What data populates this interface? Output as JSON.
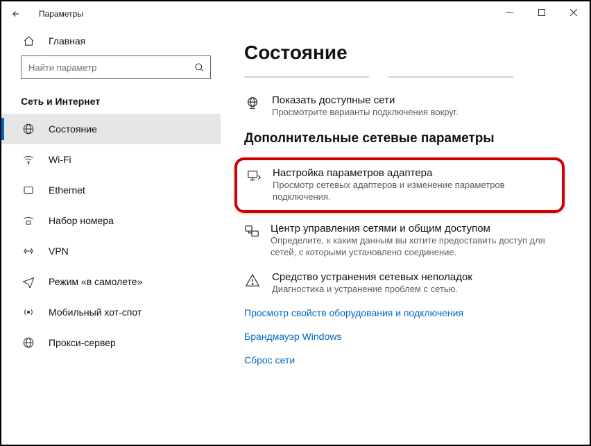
{
  "window": {
    "title": "Параметры"
  },
  "sidebar": {
    "home": "Главная",
    "search_placeholder": "Найти параметр",
    "category": "Сеть и Интернет",
    "items": [
      {
        "label": "Состояние"
      },
      {
        "label": "Wi-Fi"
      },
      {
        "label": "Ethernet"
      },
      {
        "label": "Набор номера"
      },
      {
        "label": "VPN"
      },
      {
        "label": "Режим «в самолете»"
      },
      {
        "label": "Мобильный хот-спот"
      },
      {
        "label": "Прокси-сервер"
      }
    ]
  },
  "main": {
    "heading": "Состояние",
    "available": {
      "title": "Показать доступные сети",
      "desc": "Просмотрите варианты подключения вокруг."
    },
    "section_title": "Дополнительные сетевые параметры",
    "adapter": {
      "title": "Настройка параметров адаптера",
      "desc": "Просмотр сетевых адаптеров и изменение параметров подключения."
    },
    "sharing": {
      "title": "Центр управления сетями и общим доступом",
      "desc": "Определите, к каким данным вы хотите предоставить доступ для сетей, с которыми установлено соединение."
    },
    "troubleshoot": {
      "title": "Средство устранения сетевых неполадок",
      "desc": "Диагностика и устранение проблем с сетью."
    },
    "links": {
      "hw": "Просмотр свойств оборудования и подключения",
      "fw": "Брандмауэр Windows",
      "reset": "Сброс сети"
    }
  }
}
